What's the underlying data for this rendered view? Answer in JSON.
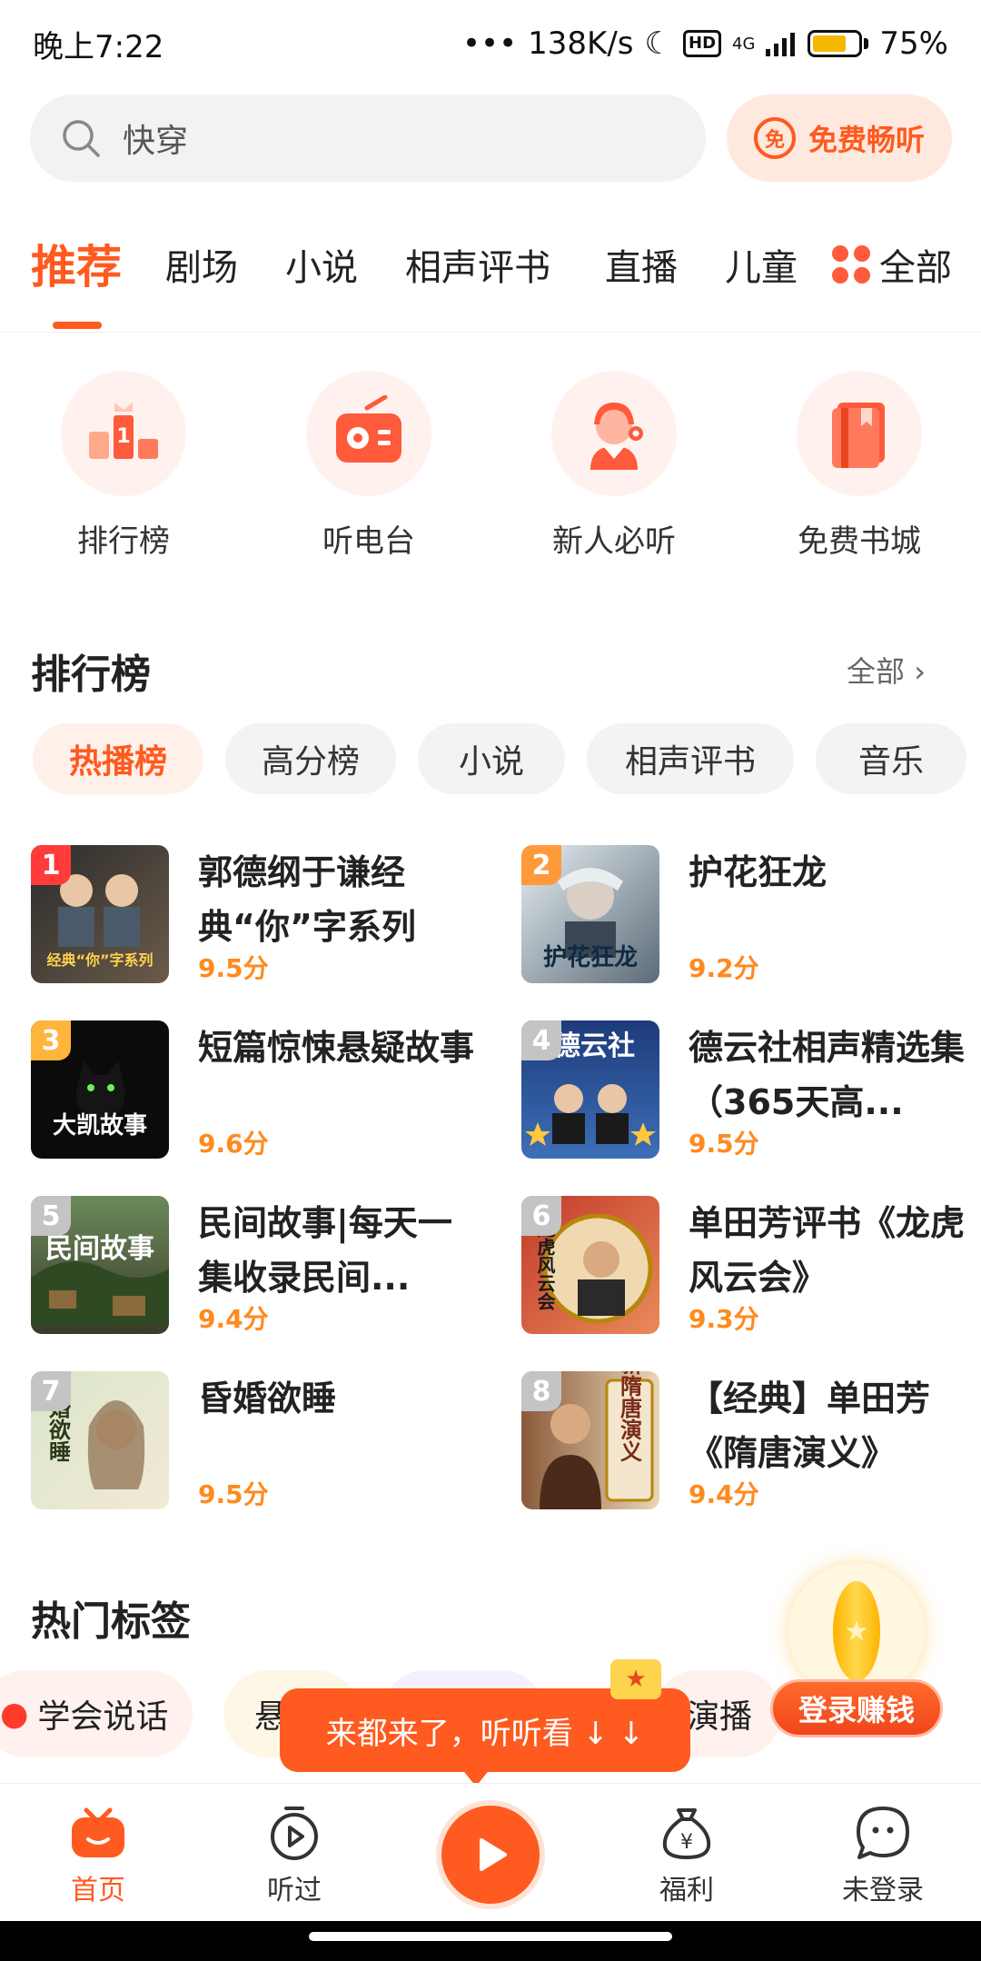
{
  "status_bar": {
    "time": "晚上7:22",
    "network_speed": "138K/s",
    "hd": "HD",
    "signal": "4G",
    "battery": "75%",
    "battery_level": 0.75
  },
  "search": {
    "placeholder": "快穿"
  },
  "free_listen": {
    "badge": "免",
    "label": "免费畅听"
  },
  "tabs": [
    {
      "label": "推荐",
      "active": true
    },
    {
      "label": "剧场"
    },
    {
      "label": "小说"
    },
    {
      "label": "相声评书"
    },
    {
      "label": "直播"
    },
    {
      "label": "儿童"
    }
  ],
  "all_tab": {
    "label": "全部"
  },
  "quick_entries": [
    {
      "label": "排行榜",
      "icon": "trophy-podium-icon"
    },
    {
      "label": "听电台",
      "icon": "radio-icon"
    },
    {
      "label": "新人必听",
      "icon": "headset-person-icon"
    },
    {
      "label": "免费书城",
      "icon": "book-icon"
    }
  ],
  "ranking": {
    "title": "排行榜",
    "more": "全部",
    "chips": [
      {
        "label": "热播榜",
        "active": true
      },
      {
        "label": "高分榜"
      },
      {
        "label": "小说"
      },
      {
        "label": "相声评书"
      },
      {
        "label": "音乐"
      }
    ],
    "items": [
      {
        "rank": "1",
        "title": "郭德纲于谦经典“你”字系列",
        "score": "9.5分",
        "colors": [
          "#2b2b2b",
          "#6b5b4a"
        ]
      },
      {
        "rank": "2",
        "title": "护花狂龙",
        "score": "9.2分",
        "colors": [
          "#c9d6de",
          "#5c6b78"
        ]
      },
      {
        "rank": "3",
        "title": "短篇惊悚悬疑故事",
        "score": "9.6分",
        "colors": [
          "#0b0b0b",
          "#2a2a2a"
        ]
      },
      {
        "rank": "4",
        "title": "德云社相声精选集（365天高...",
        "score": "9.5分",
        "colors": [
          "#1d3b7a",
          "#3d6fb8"
        ]
      },
      {
        "rank": "5",
        "title": "民间故事|每天一集收录民间...",
        "score": "9.4分",
        "colors": [
          "#3b5a2a",
          "#8a6a3a"
        ]
      },
      {
        "rank": "6",
        "title": "单田芳评书《龙虎风云会》",
        "score": "9.3分",
        "colors": [
          "#c23a2a",
          "#f0d9b0"
        ]
      },
      {
        "rank": "7",
        "title": "昏婚欲睡",
        "score": "9.5分",
        "colors": [
          "#d9e6c9",
          "#f3e9d6"
        ]
      },
      {
        "rank": "8",
        "title": "【经典】单田芳《隋唐演义》",
        "score": "9.4分",
        "colors": [
          "#8a5a3a",
          "#e9d6b5"
        ]
      }
    ],
    "cover_texts": [
      "经典“你”字系列",
      "护花狂龙",
      "大凯故事",
      "德云社",
      "民间故事",
      "龙虎风云会",
      "昏婚欲睡",
      "新隋唐演义"
    ]
  },
  "hot_tags": {
    "title": "热门标签",
    "tags": [
      {
        "label": "学会说话",
        "bg": "#fff1ee"
      },
      {
        "label": "悬",
        "bg": "#fff7e6"
      },
      {
        "label": "演播",
        "bg": "#fff1ee"
      }
    ]
  },
  "toast": {
    "text": "来都来了，听听看 ↓ ↓"
  },
  "login_promo": {
    "label": "登录赚钱"
  },
  "bottom_nav": [
    {
      "label": "首页",
      "active": true
    },
    {
      "label": "听过"
    },
    {
      "label": "福利"
    },
    {
      "label": "未登录"
    }
  ],
  "colors": {
    "accent": "#ff5a1f",
    "score": "#ff8a1f"
  }
}
